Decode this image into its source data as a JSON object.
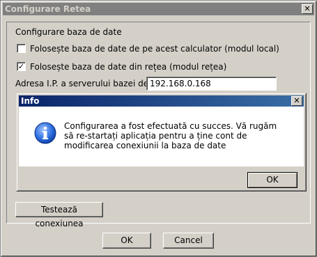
{
  "window": {
    "title": "Configurare Retea",
    "close_glyph": "✕"
  },
  "form": {
    "group_label": "Configurare baza de date",
    "option_local": {
      "label": "Folosește baza de date de pe acest calculator (modul local)",
      "checked": false
    },
    "option_network": {
      "label": "Folosește baza de date din rețea (modul rețea)",
      "checked": true,
      "check_glyph": "✓"
    },
    "ip_label": "Adresa I.P. a serverului bazei de date",
    "ip_value": "192.168.0.168",
    "test_button": "Testează conexiunea"
  },
  "footer": {
    "ok_label": "OK",
    "cancel_label": "Cancel"
  },
  "info_dialog": {
    "title": "Info",
    "close_glyph": "✕",
    "icon": "information-icon",
    "message": "Configurarea a fost efectuată cu succes. Vă rugăm să re-startați aplicația pentru a ține cont de modificarea conexiunii la baza de date",
    "ok_label": "OK"
  },
  "colors": {
    "face": "#d4d0c8",
    "active_title_start": "#0a246a",
    "active_title_end": "#3a6ea5",
    "inactive_title": "#808080"
  }
}
